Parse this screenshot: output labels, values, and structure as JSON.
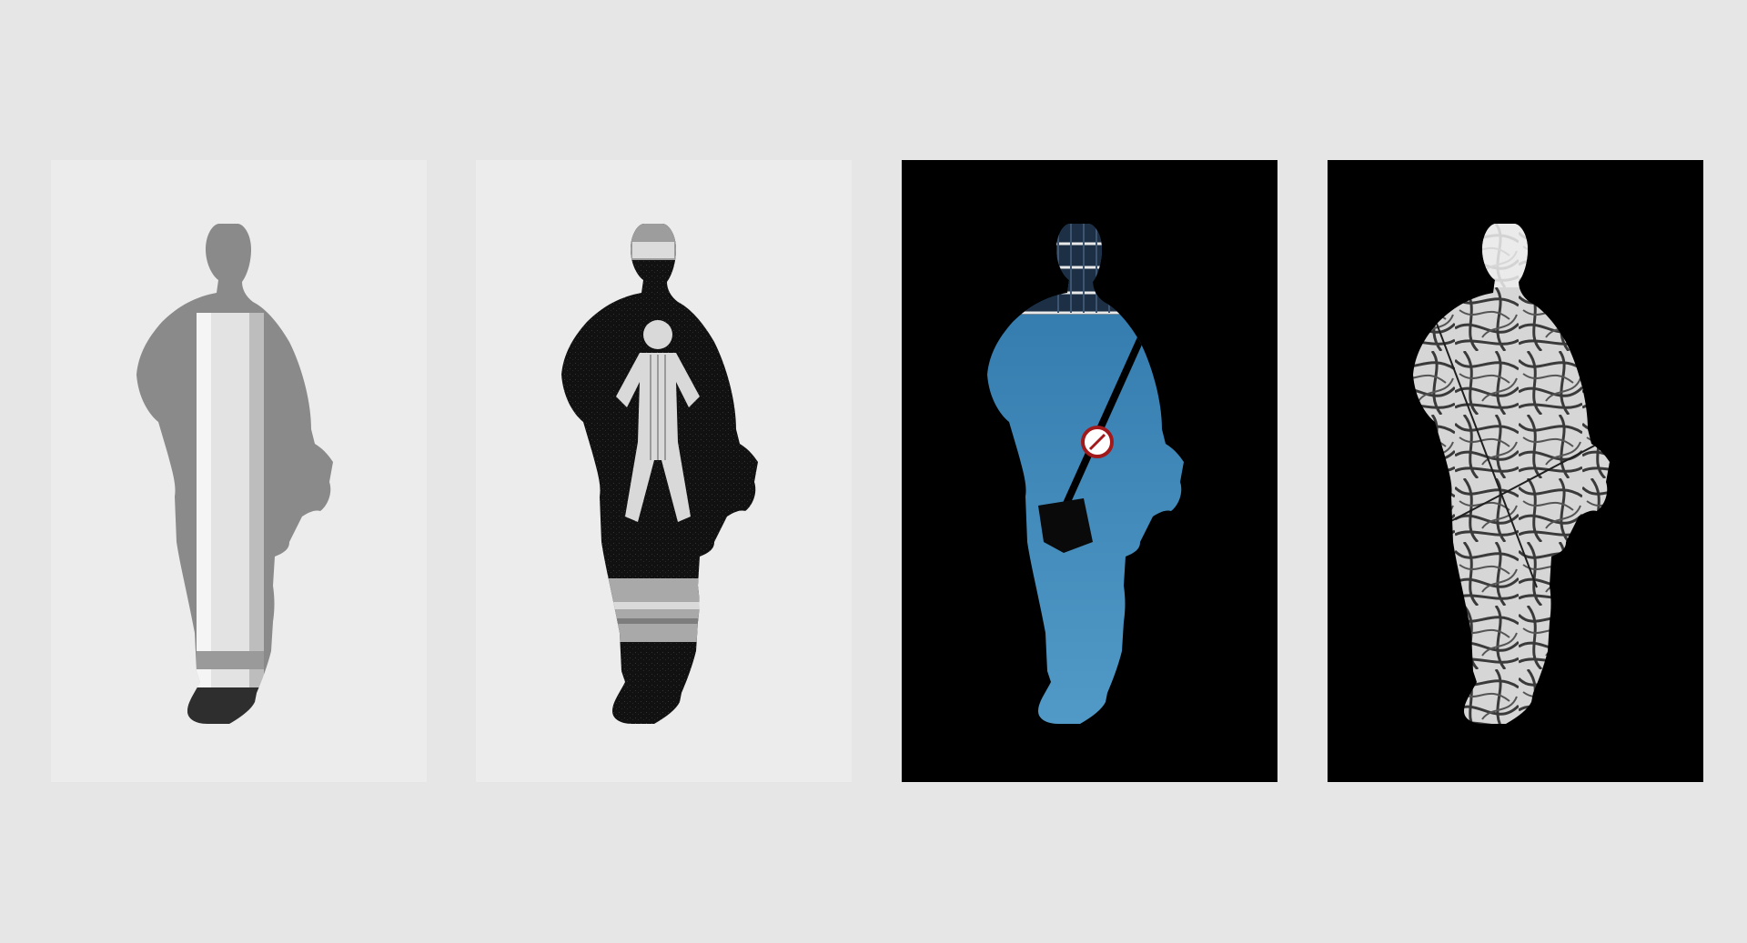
{
  "colors": {
    "page_background": "#e6e6e6",
    "panels": [
      {
        "background": "#ececec",
        "figure": "#8a8a8a",
        "inner": "#d4d4d4"
      },
      {
        "background": "#ececec",
        "figure": "#151515",
        "inner": "#bdbdbd"
      },
      {
        "background": "#000000",
        "figure": "#3f86b5",
        "inner": "#1c2f45"
      },
      {
        "background": "#000000",
        "figure": "#cfcfcf",
        "inner": "#2a2a2a"
      }
    ]
  },
  "panels": [
    {
      "icon": "silhouette-with-white-pillar-icon"
    },
    {
      "icon": "silhouette-with-pedestrian-signal-icon"
    },
    {
      "icon": "silhouette-with-sky-and-building-icon"
    },
    {
      "icon": "silhouette-with-tree-branches-icon"
    }
  ]
}
